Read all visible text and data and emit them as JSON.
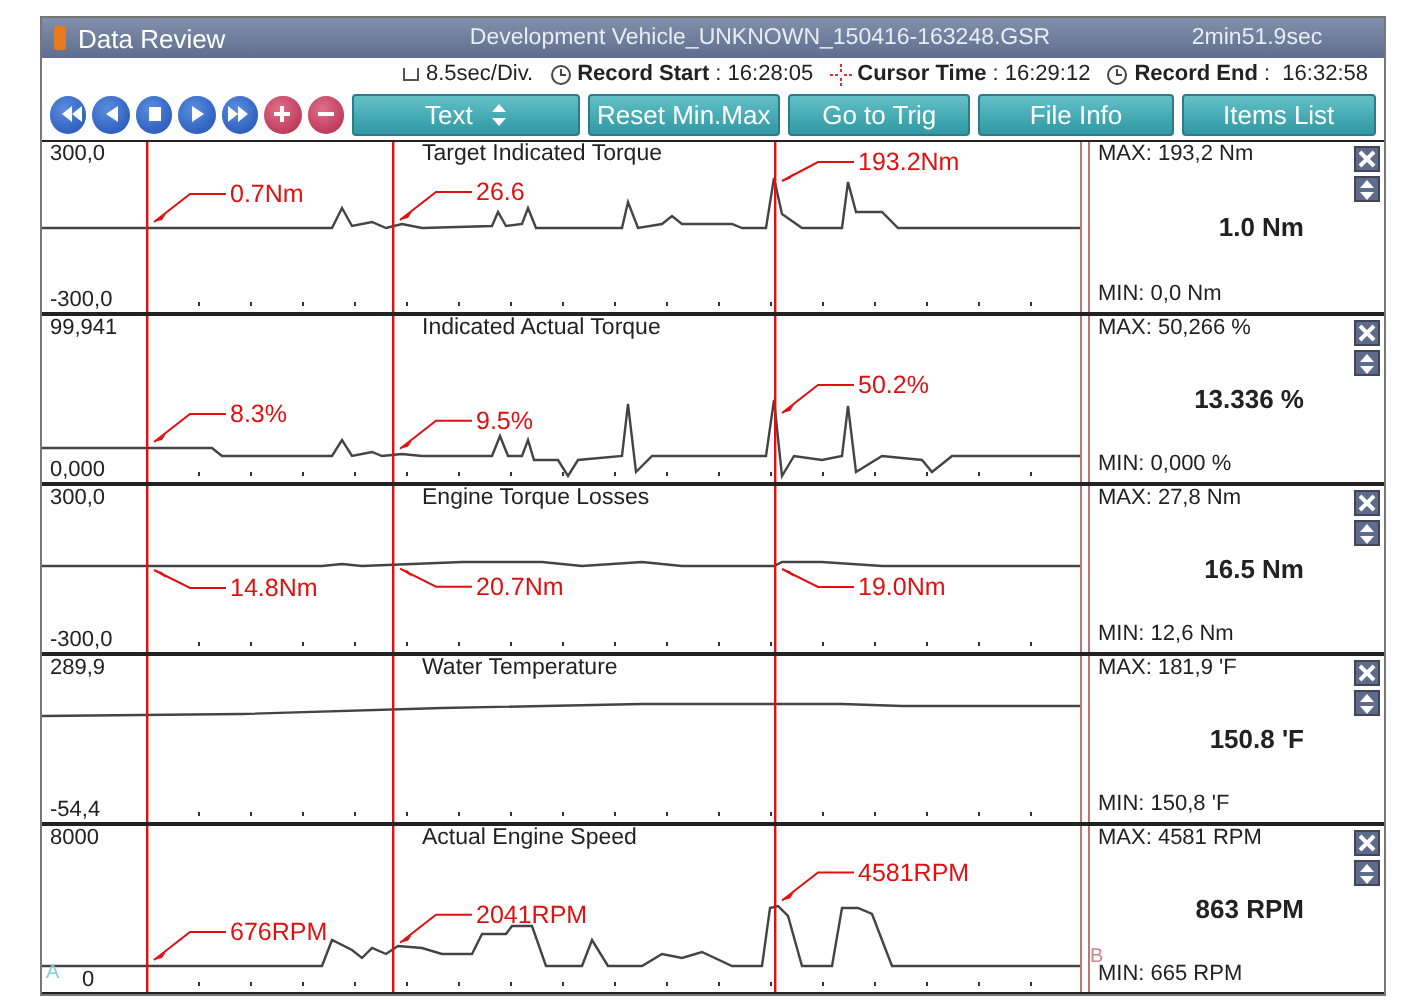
{
  "window": {
    "title": "Data Review",
    "file": "Development Vehicle_UNKNOWN_150416-163248.GSR",
    "duration": "2min51.9sec"
  },
  "info": {
    "scale": "8.5sec/Div.",
    "times": [
      {
        "kind": "start",
        "text": "**Record Start** : 16:28:05"
      },
      {
        "kind": "cursor",
        "text": "**Cursor Time** : 16:29:12"
      },
      {
        "kind": "end",
        "text": "**Record End** :  16:32:58"
      }
    ]
  },
  "toolbar": {
    "buttons": [
      {
        "label": "Text",
        "kind": "spinner"
      },
      {
        "label": "Reset Min.Max",
        "kind": "plain"
      },
      {
        "label": "Go to Trig",
        "kind": "plain"
      },
      {
        "label": "File Info",
        "kind": "plain"
      },
      {
        "label": "Items List",
        "kind": "plain"
      }
    ]
  },
  "panels": [
    {
      "title": "Target Indicated Torque",
      "y_max": "300,0",
      "y_min": "-300,0",
      "cursor_values": [
        "0.7Nm",
        "26.6",
        "193.2Nm"
      ],
      "max": "MAX: 193,2 Nm",
      "current": "1.0 Nm",
      "min": "MIN:   0,0 Nm"
    },
    {
      "title": "Indicated Actual Torque",
      "y_max": "99,941",
      "y_min": "0,000",
      "cursor_values": [
        "8.3%",
        "9.5%",
        "50.2%"
      ],
      "max": "MAX: 50,266 %",
      "current": "13.336 %",
      "min": "MIN: 0,000 %"
    },
    {
      "title": "Engine Torque Losses",
      "y_max": "300,0",
      "y_min": "-300,0",
      "cursor_values": [
        "14.8Nm",
        "20.7Nm",
        "19.0Nm"
      ],
      "max": "MAX:  27,8 Nm",
      "current": "16.5 Nm",
      "min": "MIN:  12,6 Nm"
    },
    {
      "title": "Water Temperature",
      "y_max": "289,9",
      "y_min": "-54,4",
      "max": "MAX: 181,9 'F",
      "current": "150.8 'F",
      "min": "MIN: 150,8 'F"
    },
    {
      "title": "Actual Engine Speed",
      "y_max": "8000",
      "y_min": "0",
      "cursor_values": [
        "676RPM",
        "2041RPM",
        "4581RPM"
      ],
      "max": "MAX:  4581 RPM",
      "current": "863 RPM",
      "min": "MIN:   665 RPM"
    }
  ],
  "markers": {
    "start": "A",
    "end": "B"
  }
}
